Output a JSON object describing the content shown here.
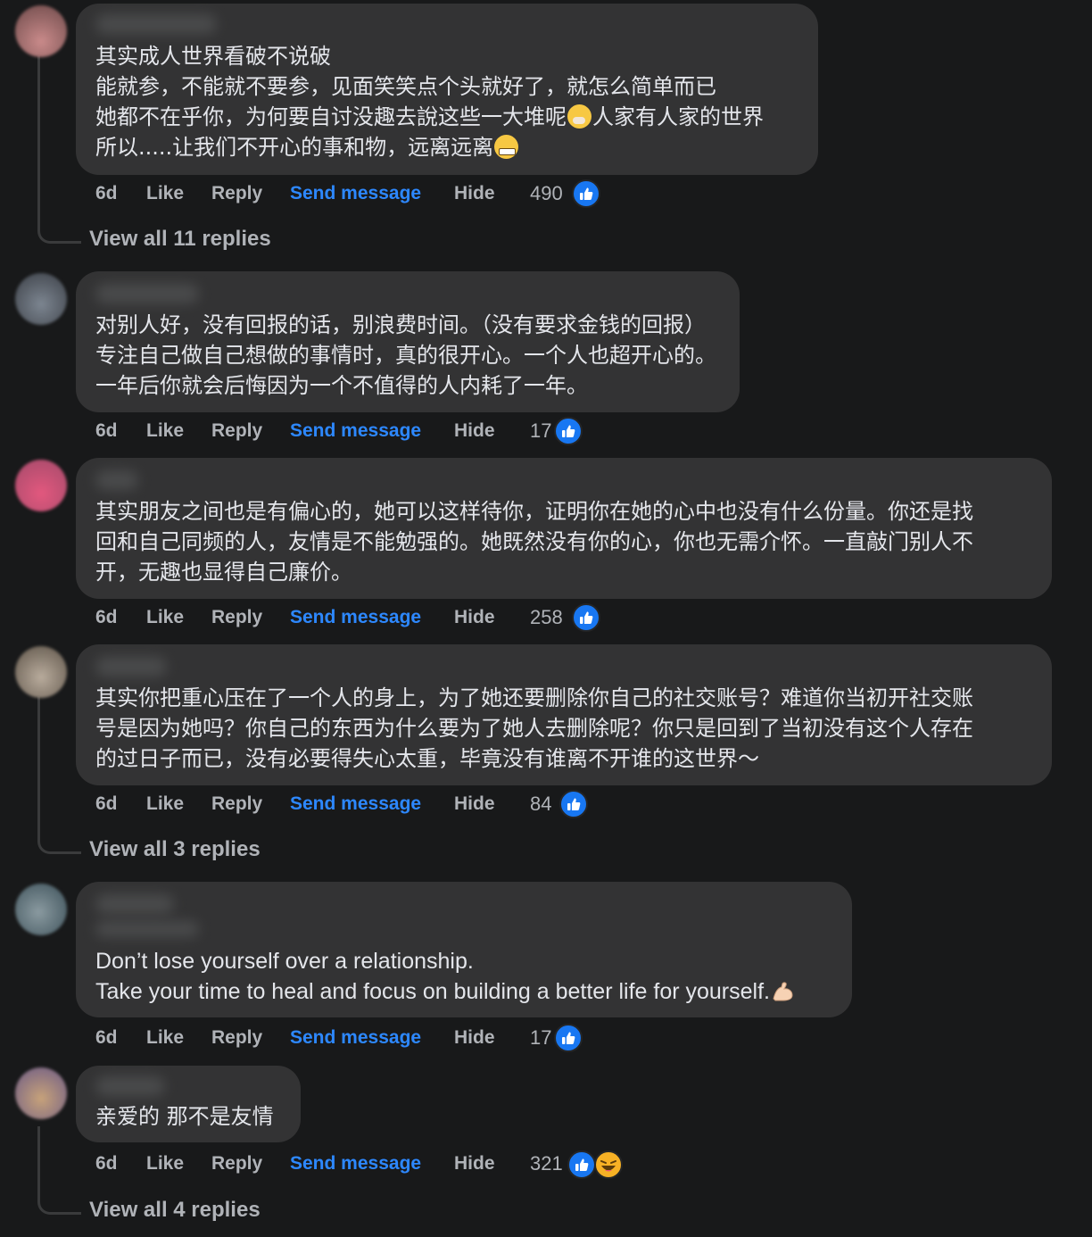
{
  "colors": {
    "background": "#18191a",
    "bubble": "#333334",
    "text": "#e4e6eb",
    "muted": "#b0b3b8",
    "link": "#2d88ff",
    "like": "#1877f2"
  },
  "actions": {
    "time": "6d",
    "like": "Like",
    "reply": "Reply",
    "send_message": "Send message",
    "hide": "Hide"
  },
  "comments": [
    {
      "lines": [
        "其实成人世界看破不说破",
        "能就参，不能就不要参，见面笑笑点个头就好了，就怎么简单而已",
        "她都不在乎你，为何要自讨没趣去說这些一大堆呢",
        "人家有人家的世界",
        "所以.....让我们不开心的事和物，远离远离"
      ],
      "inline_emojis": [
        "face-with-hand-over-mouth",
        "grimacing-face"
      ],
      "reactions": "490",
      "reaction_icons": [
        "like"
      ],
      "view_replies": "View all 11 replies"
    },
    {
      "lines": [
        "对别人好，没有回报的话，别浪费时间。（没有要求金钱的回报）",
        "专注自己做自己想做的事情时，真的很开心。一个人也超开心的。",
        "一年后你就会后悔因为一个不值得的人内耗了一年。"
      ],
      "reactions": "17",
      "reaction_icons": [
        "like"
      ]
    },
    {
      "lines": [
        "其实朋友之间也是有偏心的，她可以这样待你，证明你在她的心中也没有什么份量。你还是找",
        "回和自己同频的人，友情是不能勉强的。她既然没有你的心，你也无需介怀。一直敲门别人不",
        "开，无趣也显得自己廉价。"
      ],
      "reactions": "258",
      "reaction_icons": [
        "like"
      ]
    },
    {
      "lines": [
        "其实你把重心压在了一个人的身上，为了她还要删除你自己的社交账号？难道你当初开社交账",
        "号是因为她吗？你自己的东西为什么要为了她人去删除呢？你只是回到了当初没有这个人存在",
        "的过日子而已，没有必要得失心太重，毕竟没有谁离不开谁的这世界～"
      ],
      "reactions": "84",
      "reaction_icons": [
        "like"
      ],
      "view_replies": "View all 3 replies"
    },
    {
      "lines": [
        "Don’t lose yourself over a relationship.",
        "Take your time to heal and focus on building a better life for yourself."
      ],
      "inline_emojis": [
        "flexed-biceps"
      ],
      "reactions": "17",
      "reaction_icons": [
        "like"
      ]
    },
    {
      "lines": [
        "亲爱的 那不是友情"
      ],
      "reactions": "321",
      "reaction_icons": [
        "like",
        "haha"
      ],
      "view_replies": "View all 4 replies"
    }
  ]
}
